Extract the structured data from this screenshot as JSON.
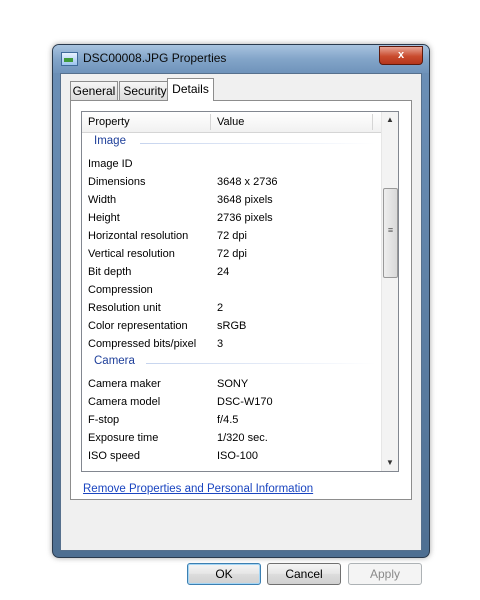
{
  "window": {
    "title": "DSC00008.JPG Properties",
    "close_glyph": "x"
  },
  "tabs": [
    {
      "label": "General"
    },
    {
      "label": "Security"
    },
    {
      "label": "Details"
    }
  ],
  "list": {
    "columns": {
      "property": "Property",
      "value": "Value"
    },
    "groups": {
      "image": "Image",
      "camera": "Camera"
    },
    "image_rows": [
      {
        "prop": "Image ID",
        "val": ""
      },
      {
        "prop": "Dimensions",
        "val": "3648 x 2736"
      },
      {
        "prop": "Width",
        "val": "3648 pixels"
      },
      {
        "prop": "Height",
        "val": "2736 pixels"
      },
      {
        "prop": "Horizontal resolution",
        "val": "72 dpi"
      },
      {
        "prop": "Vertical resolution",
        "val": "72 dpi"
      },
      {
        "prop": "Bit depth",
        "val": "24"
      },
      {
        "prop": "Compression",
        "val": ""
      },
      {
        "prop": "Resolution unit",
        "val": "2"
      },
      {
        "prop": "Color representation",
        "val": "sRGB"
      },
      {
        "prop": "Compressed bits/pixel",
        "val": "3"
      }
    ],
    "camera_rows": [
      {
        "prop": "Camera maker",
        "val": "SONY"
      },
      {
        "prop": "Camera model",
        "val": "DSC-W170"
      },
      {
        "prop": "F-stop",
        "val": "f/4.5"
      },
      {
        "prop": "Exposure time",
        "val": "1/320 sec."
      },
      {
        "prop": "ISO speed",
        "val": "ISO-100"
      }
    ]
  },
  "link": {
    "remove": "Remove Properties and Personal Information"
  },
  "buttons": {
    "ok": "OK",
    "cancel": "Cancel",
    "apply": "Apply"
  },
  "icons": {
    "scroll_up": "▲",
    "scroll_down": "▼",
    "scroll_grip": "≡",
    "window_icon": "image-file-icon"
  },
  "colors": {
    "group_label": "#1e3f9a",
    "link": "#1a45c0",
    "close_button": "#c94b2e"
  }
}
